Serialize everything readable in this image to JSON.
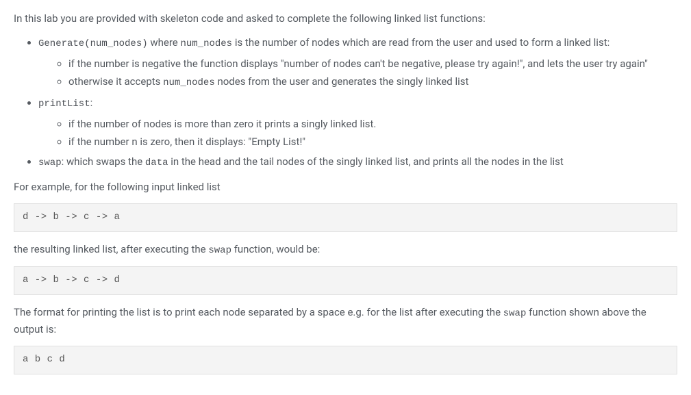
{
  "intro": "In this lab you are provided with skeleton code and asked to complete the following linked list functions:",
  "bullets": {
    "generate": {
      "func": "Generate(num_nodes)",
      "mid_text": " where ",
      "arg": "num_nodes",
      "tail_text": " is the number of nodes which are read from the user and used to form a linked list:",
      "sub1": "if the number is negative the function displays \"number of nodes can't be negative, please try again!\", and lets the user try again\"",
      "sub2_pre": "otherwise it accepts ",
      "sub2_code": "num_nodes",
      "sub2_post": " nodes from the user and generates the singly linked list"
    },
    "printList": {
      "func": "printList",
      "sub1": "if the number of nodes is more than zero it prints a singly linked list.",
      "sub2": "if the number n is zero, then it displays: \"Empty List!\""
    },
    "swap": {
      "func": "swap",
      "text1": ": which swaps the ",
      "code2": "data",
      "text2": " in the head and the tail nodes of the singly linked list, and prints all the nodes in the list"
    }
  },
  "example_intro": "For example, for the following input linked list",
  "code1": "d -> b -> c -> a",
  "resulting_pre": "the resulting linked list, after executing the ",
  "resulting_code": "swap",
  "resulting_post": " function, would be:",
  "code2": "a -> b -> c -> d",
  "format_pre": "The format for printing the list is to print each node separated by a space e.g. for the list after executing the ",
  "format_code": "swap",
  "format_post": " function shown above the output is:",
  "code3": "a b c d"
}
